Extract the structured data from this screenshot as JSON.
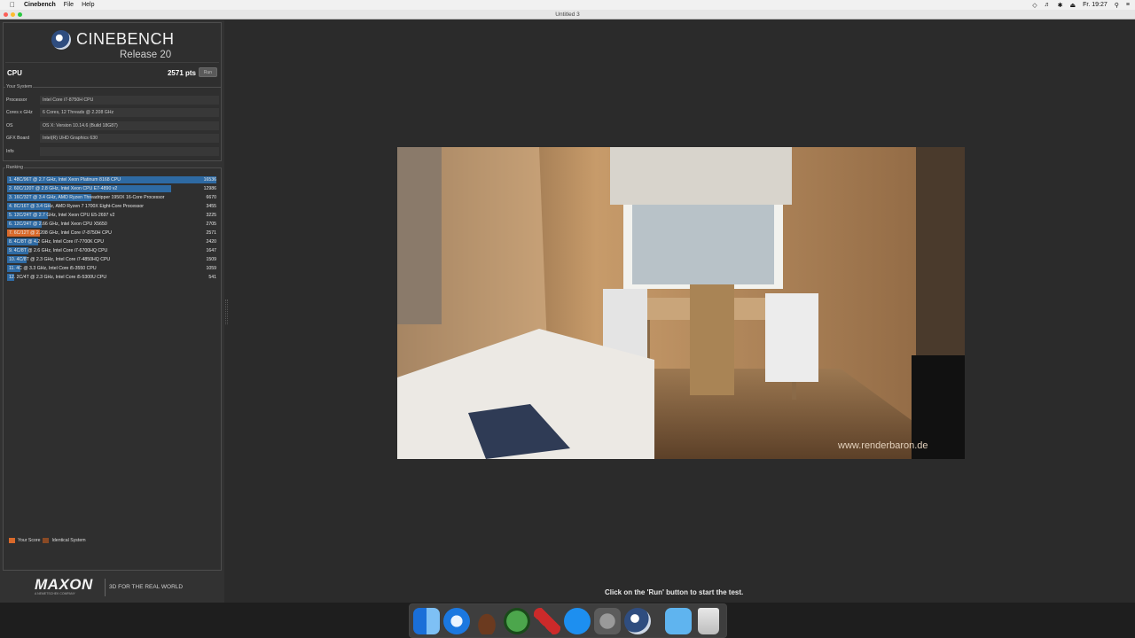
{
  "menubar": {
    "app_name": "Cinebench",
    "menus": [
      "File",
      "Help"
    ],
    "clock": "Fr. 19:27"
  },
  "window": {
    "title": "Untitled 3"
  },
  "header": {
    "brand": "CINEBENCH",
    "release": "Release 20",
    "test_label": "CPU",
    "score": "2571 pts",
    "run_label": "Run"
  },
  "your_system": {
    "title": "Your System",
    "rows": [
      {
        "key": "Processor",
        "value": "Intel Core i7-8750H CPU"
      },
      {
        "key": "Cores x GHz",
        "value": "6 Cores, 12 Threads @ 2.208 GHz"
      },
      {
        "key": "OS",
        "value": "OS X: Version 10.14.6 (Build 18G87)"
      },
      {
        "key": "GFX Board",
        "value": "Intel(R) UHD Graphics 630"
      },
      {
        "key": "Info",
        "value": ""
      }
    ]
  },
  "ranking": {
    "title": "Ranking",
    "max_score": 16536,
    "items": [
      {
        "label": "1. 48C/96T @ 2.7 GHz, Intel Xeon Platinum 8168 CPU",
        "score": 16536,
        "highlight": false
      },
      {
        "label": "2. 60C/120T @ 2.8 GHz, Intel Xeon CPU E7-4890 v2",
        "score": 12986,
        "highlight": false
      },
      {
        "label": "3. 16C/32T @ 3.4 GHz, AMD Ryzen Threadripper 1950X 16-Core Processor",
        "score": 6670,
        "highlight": false
      },
      {
        "label": "4. 8C/16T @ 3.4 GHz, AMD Ryzen 7 1700X Eight-Core Processor",
        "score": 3455,
        "highlight": false
      },
      {
        "label": "5. 12C/24T @ 2.7 GHz, Intel Xeon CPU E5-2697 v2",
        "score": 3225,
        "highlight": false
      },
      {
        "label": "6. 12C/24T @ 2.66 GHz, Intel Xeon CPU X5650",
        "score": 2705,
        "highlight": false
      },
      {
        "label": "7. 6C/12T @ 2.208 GHz, Intel Core i7-8750H CPU",
        "score": 2571,
        "highlight": true
      },
      {
        "label": "8. 4C/8T @ 4.2 GHz, Intel Core i7-7700K CPU",
        "score": 2420,
        "highlight": false
      },
      {
        "label": "9. 4C/8T @ 2.6 GHz, Intel Core i7-6700HQ CPU",
        "score": 1647,
        "highlight": false
      },
      {
        "label": "10. 4C/8T @ 2.3 GHz, Intel Core i7-4850HQ CPU",
        "score": 1509,
        "highlight": false
      },
      {
        "label": "11. 4C @ 3.3 GHz, Intel Core i5-3550 CPU",
        "score": 1059,
        "highlight": false
      },
      {
        "label": "12. 2C/4T @ 2.3 GHz, Intel Core i5-5300U CPU",
        "score": 541,
        "highlight": false
      }
    ],
    "legend": {
      "your_score": "Your Score",
      "identical": "Identical System"
    }
  },
  "footer": {
    "brand": "MAXON",
    "brand_sub": "A NEMETSCHEK COMPANY",
    "tagline": "3D FOR THE REAL WORLD"
  },
  "render": {
    "watermark": "www.renderbaron.de"
  },
  "status_hint": "Click on the 'Run' button to start the test.",
  "dock": [
    "finder-icon",
    "safari-icon",
    "hat-app-icon",
    "globe-app-icon",
    "tool-app-icon",
    "app-store-icon",
    "system-preferences-icon",
    "cinebench-icon",
    "downloads-folder-icon",
    "trash-icon"
  ],
  "colors": {
    "bar": "#2e6aa3",
    "your_score": "#d9692a",
    "identical": "#8a4a25"
  }
}
